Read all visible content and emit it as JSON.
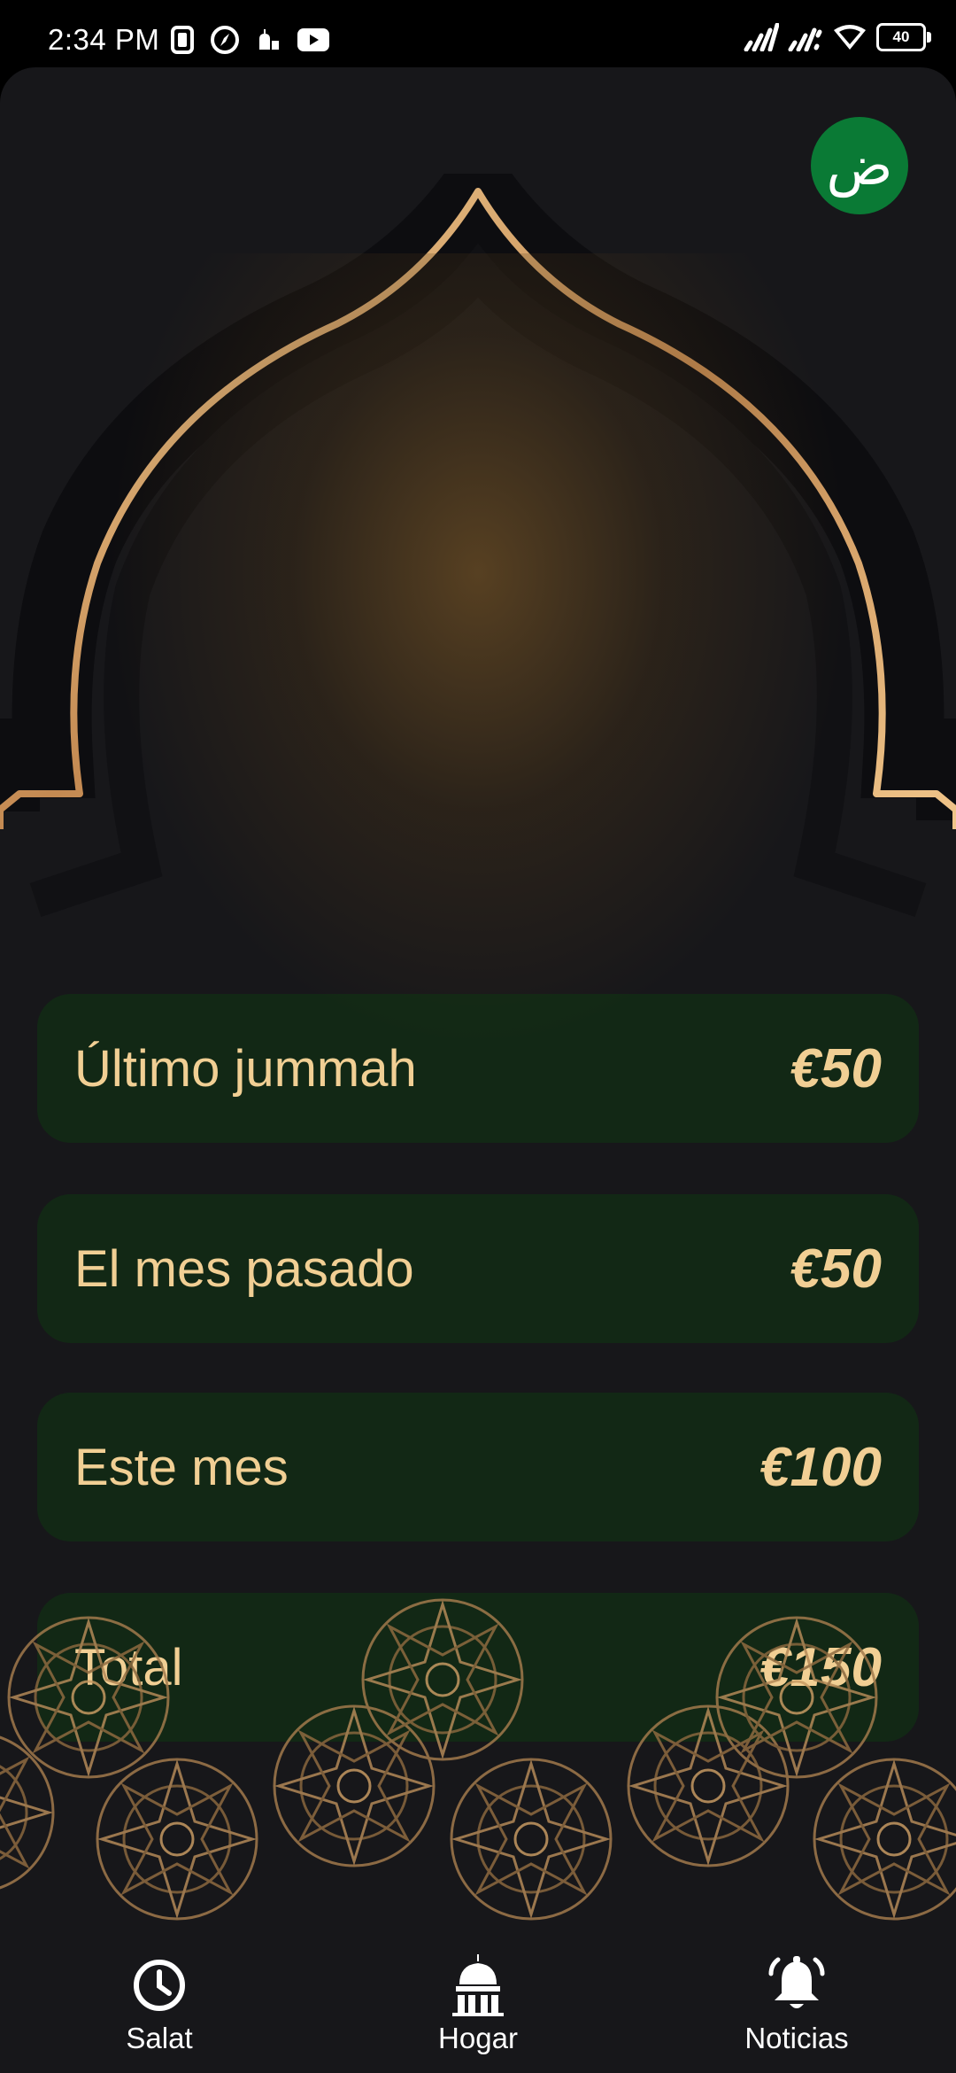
{
  "status_bar": {
    "time": "2:34 PM",
    "battery": "40",
    "left_icons": [
      "phone-frame-icon",
      "compass-icon",
      "mosque-notification-icon",
      "youtube-icon"
    ],
    "right_icons": [
      "signal-icon",
      "signal-icon",
      "wifi-icon",
      "battery-icon"
    ]
  },
  "header": {
    "language_button": {
      "glyph": "ض",
      "color": "#0a7a35"
    }
  },
  "stats": [
    {
      "label": "Último jummah",
      "value": "€50"
    },
    {
      "label": "El mes pasado",
      "value": "€50"
    },
    {
      "label": "Este mes",
      "value": "€100"
    },
    {
      "label": "Total",
      "value": "€150"
    }
  ],
  "colors": {
    "accent_gold": "#f1cf94",
    "card_green": "#103414",
    "background": "#17171a"
  },
  "bottom_nav": {
    "items": [
      {
        "label": "Salat",
        "icon": "clock-icon"
      },
      {
        "label": "Hogar",
        "icon": "mosque-icon"
      },
      {
        "label": "Noticias",
        "icon": "bell-icon"
      }
    ]
  }
}
